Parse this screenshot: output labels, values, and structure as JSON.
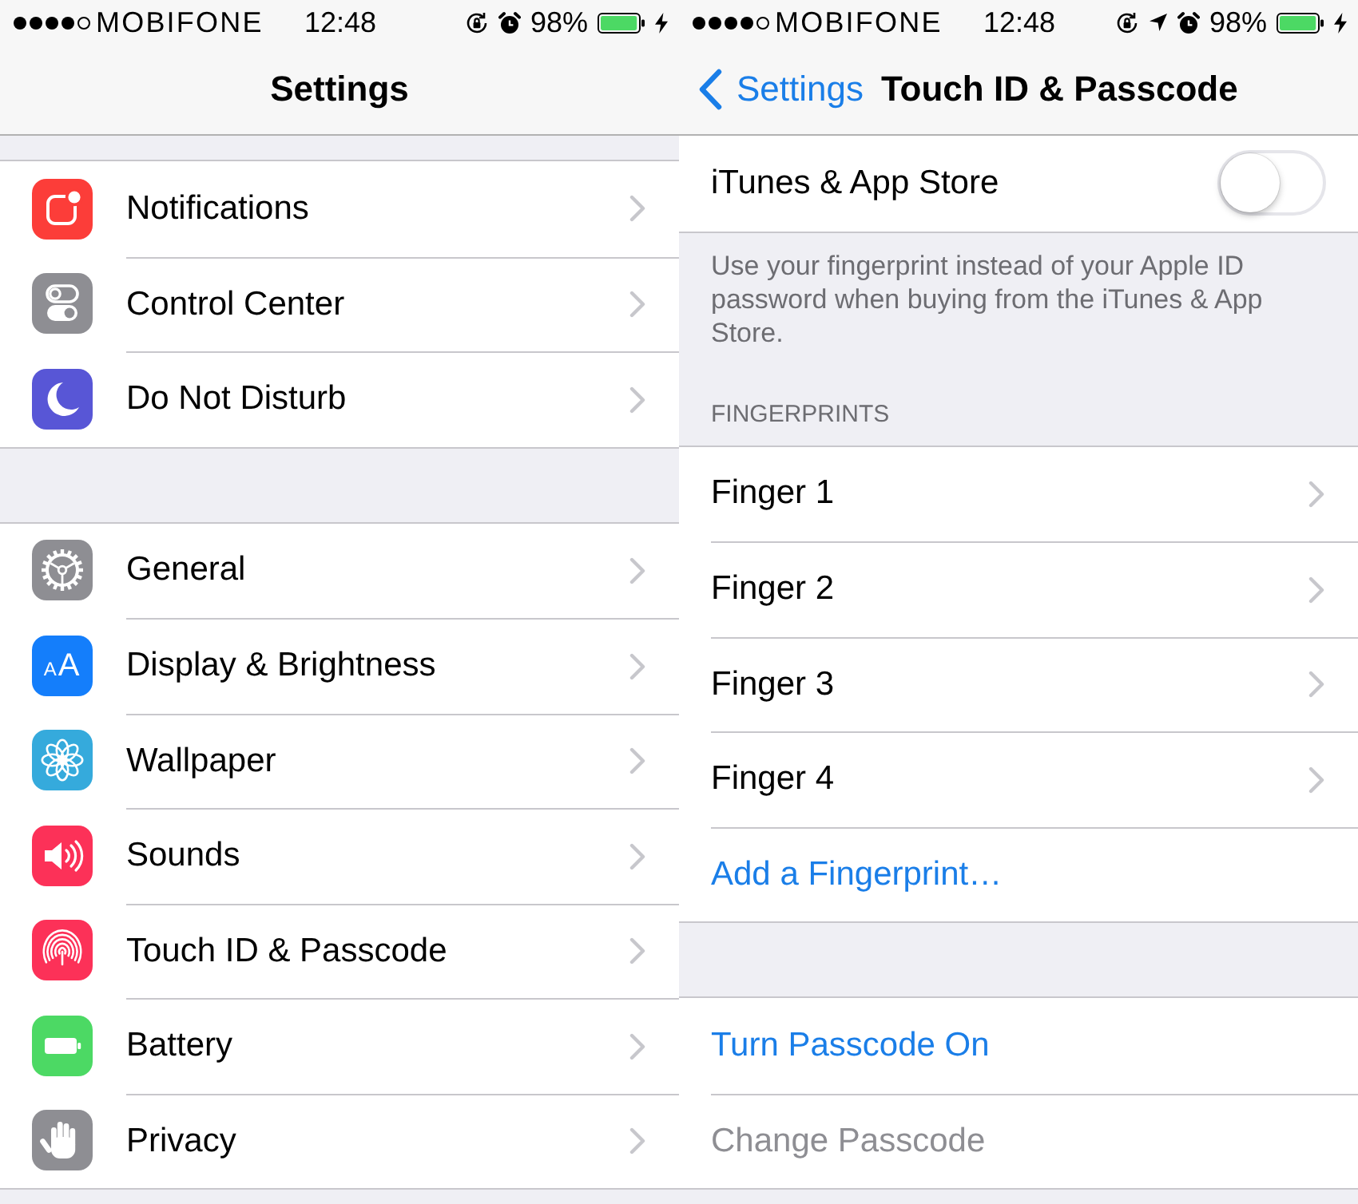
{
  "screens": [
    {
      "status_bar": {
        "carrier": "MOBIFONE",
        "time": "12:48",
        "battery": "98%",
        "rotation_lock": true,
        "location": false,
        "alarm": true,
        "charging": true
      },
      "nav_bar": {
        "title": "Settings"
      },
      "groups": [
        {
          "items": [
            {
              "kind": "disclosure",
              "label": "Notifications",
              "color": "#fc3d39"
            },
            {
              "kind": "disclosure",
              "label": "Control Center",
              "color": "#8e8e93"
            },
            {
              "kind": "disclosure",
              "label": "Do Not Disturb",
              "color": "#5856d6"
            }
          ]
        },
        {
          "items": [
            {
              "kind": "disclosure",
              "label": "General",
              "color": "#8e8e93"
            },
            {
              "kind": "disclosure",
              "label": "Display & Brightness",
              "color": "#147efb",
              "icon_text": "AA"
            },
            {
              "kind": "disclosure",
              "label": "Wallpaper",
              "color": "#35aadc"
            },
            {
              "kind": "disclosure",
              "label": "Sounds",
              "color": "#fc3158"
            },
            {
              "kind": "disclosure",
              "label": "Touch ID & Passcode",
              "color": "#fc3158"
            },
            {
              "kind": "disclosure",
              "label": "Battery",
              "color": "#4cd964"
            },
            {
              "kind": "disclosure",
              "label": "Privacy",
              "color": "#8e8e93"
            }
          ]
        }
      ]
    },
    {
      "status_bar": {
        "carrier": "MOBIFONE",
        "time": "12:48",
        "battery": "98%",
        "rotation_lock": true,
        "location": true,
        "alarm": true,
        "charging": true
      },
      "nav_bar": {
        "back": "Settings",
        "title": "Touch ID & Passcode"
      },
      "groups": [
        {
          "items": [
            {
              "kind": "toggle",
              "label": "iTunes & App Store",
              "on": false
            }
          ],
          "footer": "Use your fingerprint instead of your Apple ID password when buying from the iTunes & App Store."
        },
        {
          "header": "FINGERPRINTS",
          "items": [
            {
              "kind": "disclosure",
              "label": "Finger 1"
            },
            {
              "kind": "disclosure",
              "label": "Finger 2"
            },
            {
              "kind": "disclosure",
              "label": "Finger 3"
            },
            {
              "kind": "disclosure",
              "label": "Finger 4"
            },
            {
              "kind": "action",
              "label": "Add a Fingerprint…",
              "disabled": false
            }
          ]
        },
        {
          "items": [
            {
              "kind": "action",
              "label": "Turn Passcode On",
              "disabled": false
            },
            {
              "kind": "action",
              "label": "Change Passcode",
              "disabled": true
            }
          ]
        }
      ]
    }
  ]
}
